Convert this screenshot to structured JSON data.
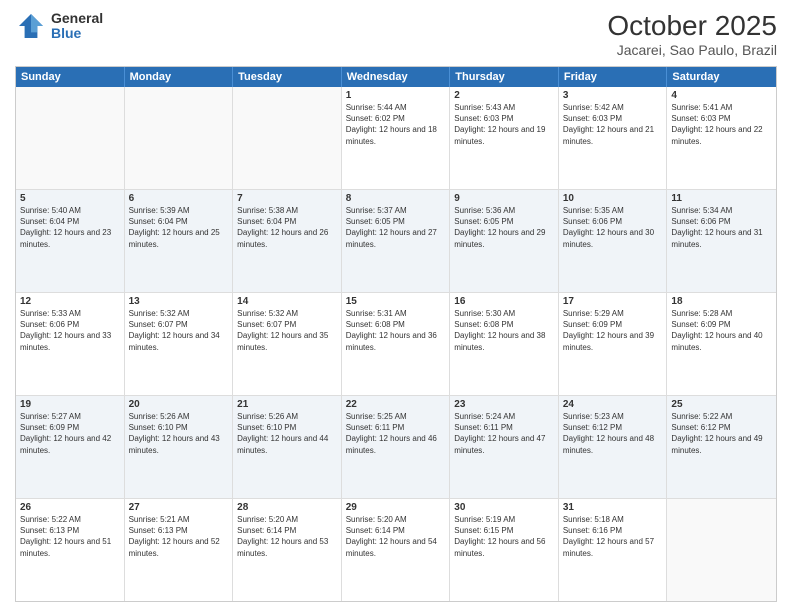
{
  "header": {
    "logo": {
      "general": "General",
      "blue": "Blue"
    },
    "title": "October 2025",
    "location": "Jacarei, Sao Paulo, Brazil"
  },
  "days_of_week": [
    "Sunday",
    "Monday",
    "Tuesday",
    "Wednesday",
    "Thursday",
    "Friday",
    "Saturday"
  ],
  "weeks": [
    [
      {
        "day": "",
        "empty": true
      },
      {
        "day": "",
        "empty": true
      },
      {
        "day": "",
        "empty": true
      },
      {
        "day": "1",
        "sunrise": "Sunrise: 5:44 AM",
        "sunset": "Sunset: 6:02 PM",
        "daylight": "Daylight: 12 hours and 18 minutes."
      },
      {
        "day": "2",
        "sunrise": "Sunrise: 5:43 AM",
        "sunset": "Sunset: 6:03 PM",
        "daylight": "Daylight: 12 hours and 19 minutes."
      },
      {
        "day": "3",
        "sunrise": "Sunrise: 5:42 AM",
        "sunset": "Sunset: 6:03 PM",
        "daylight": "Daylight: 12 hours and 21 minutes."
      },
      {
        "day": "4",
        "sunrise": "Sunrise: 5:41 AM",
        "sunset": "Sunset: 6:03 PM",
        "daylight": "Daylight: 12 hours and 22 minutes."
      }
    ],
    [
      {
        "day": "5",
        "sunrise": "Sunrise: 5:40 AM",
        "sunset": "Sunset: 6:04 PM",
        "daylight": "Daylight: 12 hours and 23 minutes."
      },
      {
        "day": "6",
        "sunrise": "Sunrise: 5:39 AM",
        "sunset": "Sunset: 6:04 PM",
        "daylight": "Daylight: 12 hours and 25 minutes."
      },
      {
        "day": "7",
        "sunrise": "Sunrise: 5:38 AM",
        "sunset": "Sunset: 6:04 PM",
        "daylight": "Daylight: 12 hours and 26 minutes."
      },
      {
        "day": "8",
        "sunrise": "Sunrise: 5:37 AM",
        "sunset": "Sunset: 6:05 PM",
        "daylight": "Daylight: 12 hours and 27 minutes."
      },
      {
        "day": "9",
        "sunrise": "Sunrise: 5:36 AM",
        "sunset": "Sunset: 6:05 PM",
        "daylight": "Daylight: 12 hours and 29 minutes."
      },
      {
        "day": "10",
        "sunrise": "Sunrise: 5:35 AM",
        "sunset": "Sunset: 6:06 PM",
        "daylight": "Daylight: 12 hours and 30 minutes."
      },
      {
        "day": "11",
        "sunrise": "Sunrise: 5:34 AM",
        "sunset": "Sunset: 6:06 PM",
        "daylight": "Daylight: 12 hours and 31 minutes."
      }
    ],
    [
      {
        "day": "12",
        "sunrise": "Sunrise: 5:33 AM",
        "sunset": "Sunset: 6:06 PM",
        "daylight": "Daylight: 12 hours and 33 minutes."
      },
      {
        "day": "13",
        "sunrise": "Sunrise: 5:32 AM",
        "sunset": "Sunset: 6:07 PM",
        "daylight": "Daylight: 12 hours and 34 minutes."
      },
      {
        "day": "14",
        "sunrise": "Sunrise: 5:32 AM",
        "sunset": "Sunset: 6:07 PM",
        "daylight": "Daylight: 12 hours and 35 minutes."
      },
      {
        "day": "15",
        "sunrise": "Sunrise: 5:31 AM",
        "sunset": "Sunset: 6:08 PM",
        "daylight": "Daylight: 12 hours and 36 minutes."
      },
      {
        "day": "16",
        "sunrise": "Sunrise: 5:30 AM",
        "sunset": "Sunset: 6:08 PM",
        "daylight": "Daylight: 12 hours and 38 minutes."
      },
      {
        "day": "17",
        "sunrise": "Sunrise: 5:29 AM",
        "sunset": "Sunset: 6:09 PM",
        "daylight": "Daylight: 12 hours and 39 minutes."
      },
      {
        "day": "18",
        "sunrise": "Sunrise: 5:28 AM",
        "sunset": "Sunset: 6:09 PM",
        "daylight": "Daylight: 12 hours and 40 minutes."
      }
    ],
    [
      {
        "day": "19",
        "sunrise": "Sunrise: 5:27 AM",
        "sunset": "Sunset: 6:09 PM",
        "daylight": "Daylight: 12 hours and 42 minutes."
      },
      {
        "day": "20",
        "sunrise": "Sunrise: 5:26 AM",
        "sunset": "Sunset: 6:10 PM",
        "daylight": "Daylight: 12 hours and 43 minutes."
      },
      {
        "day": "21",
        "sunrise": "Sunrise: 5:26 AM",
        "sunset": "Sunset: 6:10 PM",
        "daylight": "Daylight: 12 hours and 44 minutes."
      },
      {
        "day": "22",
        "sunrise": "Sunrise: 5:25 AM",
        "sunset": "Sunset: 6:11 PM",
        "daylight": "Daylight: 12 hours and 46 minutes."
      },
      {
        "day": "23",
        "sunrise": "Sunrise: 5:24 AM",
        "sunset": "Sunset: 6:11 PM",
        "daylight": "Daylight: 12 hours and 47 minutes."
      },
      {
        "day": "24",
        "sunrise": "Sunrise: 5:23 AM",
        "sunset": "Sunset: 6:12 PM",
        "daylight": "Daylight: 12 hours and 48 minutes."
      },
      {
        "day": "25",
        "sunrise": "Sunrise: 5:22 AM",
        "sunset": "Sunset: 6:12 PM",
        "daylight": "Daylight: 12 hours and 49 minutes."
      }
    ],
    [
      {
        "day": "26",
        "sunrise": "Sunrise: 5:22 AM",
        "sunset": "Sunset: 6:13 PM",
        "daylight": "Daylight: 12 hours and 51 minutes."
      },
      {
        "day": "27",
        "sunrise": "Sunrise: 5:21 AM",
        "sunset": "Sunset: 6:13 PM",
        "daylight": "Daylight: 12 hours and 52 minutes."
      },
      {
        "day": "28",
        "sunrise": "Sunrise: 5:20 AM",
        "sunset": "Sunset: 6:14 PM",
        "daylight": "Daylight: 12 hours and 53 minutes."
      },
      {
        "day": "29",
        "sunrise": "Sunrise: 5:20 AM",
        "sunset": "Sunset: 6:14 PM",
        "daylight": "Daylight: 12 hours and 54 minutes."
      },
      {
        "day": "30",
        "sunrise": "Sunrise: 5:19 AM",
        "sunset": "Sunset: 6:15 PM",
        "daylight": "Daylight: 12 hours and 56 minutes."
      },
      {
        "day": "31",
        "sunrise": "Sunrise: 5:18 AM",
        "sunset": "Sunset: 6:16 PM",
        "daylight": "Daylight: 12 hours and 57 minutes."
      },
      {
        "day": "",
        "empty": true
      }
    ]
  ]
}
